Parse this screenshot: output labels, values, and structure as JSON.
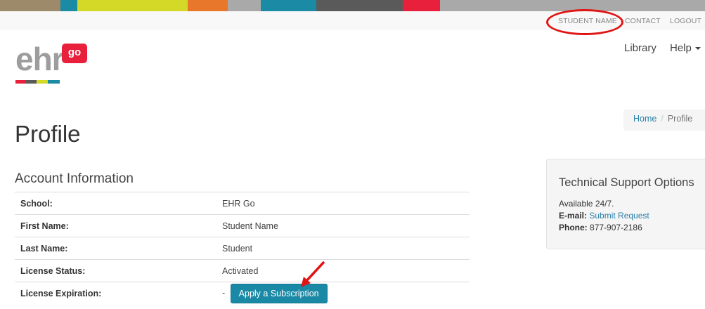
{
  "top_strip": {
    "colors": [
      "#9c8a6a",
      "#1b8aa5",
      "#d4d928",
      "#e8762b",
      "#a9a9a9",
      "#1b8aa5",
      "#5a5a5a",
      "#e8203c",
      "#a9a9a9"
    ]
  },
  "utility_nav": {
    "student_name": "STUDENT NAME",
    "contact": "CONTACT",
    "logout": "LOGOUT"
  },
  "logo": {
    "text": "ehr",
    "badge": "go",
    "bar_colors": [
      "#e8203c",
      "#5a5a5a",
      "#d4d928",
      "#1b8aa5"
    ]
  },
  "main_nav": {
    "library": "Library",
    "help": "Help"
  },
  "breadcrumb": {
    "home": "Home",
    "separator": "/",
    "current": "Profile"
  },
  "page": {
    "title": "Profile"
  },
  "account": {
    "section_title": "Account Information",
    "rows": [
      {
        "label": "School:",
        "value": "EHR Go"
      },
      {
        "label": "First Name:",
        "value": "Student Name"
      },
      {
        "label": "Last Name:",
        "value": "Student"
      },
      {
        "label": "License Status:",
        "value": "Activated"
      },
      {
        "label": "License Expiration:",
        "value": "-"
      }
    ],
    "apply_button": "Apply a Subscription"
  },
  "support": {
    "title": "Technical Support Options",
    "availability": "Available 24/7.",
    "email_label": "E-mail:",
    "email_link": "Submit Request",
    "phone_label": "Phone:",
    "phone_value": "877-907-2186"
  },
  "colors": {
    "accent": "#1a89a6",
    "link": "#2a7fa8",
    "annotation": "#e11414",
    "brand_red": "#e8203c"
  }
}
